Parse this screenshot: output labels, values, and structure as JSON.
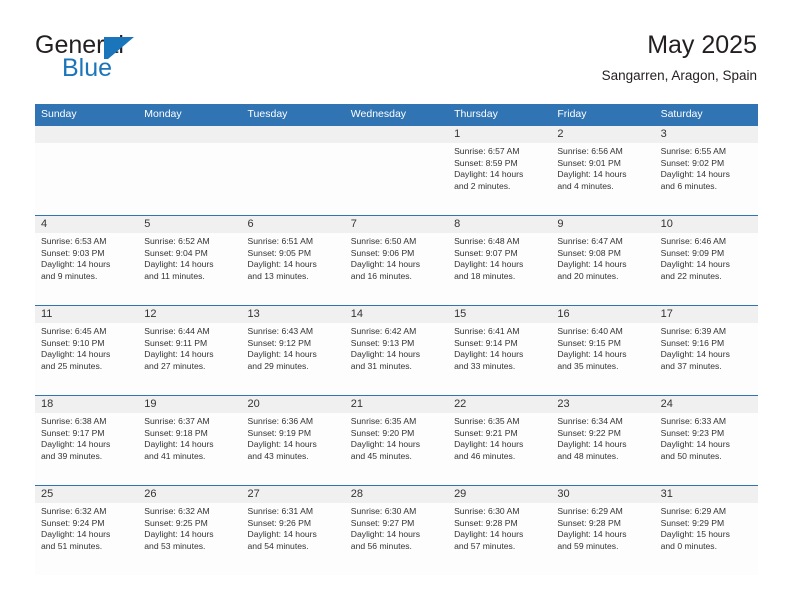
{
  "brand": {
    "name_part1": "General",
    "name_part2": "Blue",
    "accent_color": "#1b75bb"
  },
  "header": {
    "title": "May 2025",
    "location": "Sangarren, Aragon, Spain"
  },
  "calendar": {
    "header_color": "#3174b4",
    "weekdays": [
      "Sunday",
      "Monday",
      "Tuesday",
      "Wednesday",
      "Thursday",
      "Friday",
      "Saturday"
    ],
    "weeks": [
      [
        {
          "day": "",
          "lines": []
        },
        {
          "day": "",
          "lines": []
        },
        {
          "day": "",
          "lines": []
        },
        {
          "day": "",
          "lines": []
        },
        {
          "day": "1",
          "lines": [
            "Sunrise: 6:57 AM",
            "Sunset: 8:59 PM",
            "Daylight: 14 hours",
            "and 2 minutes."
          ]
        },
        {
          "day": "2",
          "lines": [
            "Sunrise: 6:56 AM",
            "Sunset: 9:01 PM",
            "Daylight: 14 hours",
            "and 4 minutes."
          ]
        },
        {
          "day": "3",
          "lines": [
            "Sunrise: 6:55 AM",
            "Sunset: 9:02 PM",
            "Daylight: 14 hours",
            "and 6 minutes."
          ]
        }
      ],
      [
        {
          "day": "4",
          "lines": [
            "Sunrise: 6:53 AM",
            "Sunset: 9:03 PM",
            "Daylight: 14 hours",
            "and 9 minutes."
          ]
        },
        {
          "day": "5",
          "lines": [
            "Sunrise: 6:52 AM",
            "Sunset: 9:04 PM",
            "Daylight: 14 hours",
            "and 11 minutes."
          ]
        },
        {
          "day": "6",
          "lines": [
            "Sunrise: 6:51 AM",
            "Sunset: 9:05 PM",
            "Daylight: 14 hours",
            "and 13 minutes."
          ]
        },
        {
          "day": "7",
          "lines": [
            "Sunrise: 6:50 AM",
            "Sunset: 9:06 PM",
            "Daylight: 14 hours",
            "and 16 minutes."
          ]
        },
        {
          "day": "8",
          "lines": [
            "Sunrise: 6:48 AM",
            "Sunset: 9:07 PM",
            "Daylight: 14 hours",
            "and 18 minutes."
          ]
        },
        {
          "day": "9",
          "lines": [
            "Sunrise: 6:47 AM",
            "Sunset: 9:08 PM",
            "Daylight: 14 hours",
            "and 20 minutes."
          ]
        },
        {
          "day": "10",
          "lines": [
            "Sunrise: 6:46 AM",
            "Sunset: 9:09 PM",
            "Daylight: 14 hours",
            "and 22 minutes."
          ]
        }
      ],
      [
        {
          "day": "11",
          "lines": [
            "Sunrise: 6:45 AM",
            "Sunset: 9:10 PM",
            "Daylight: 14 hours",
            "and 25 minutes."
          ]
        },
        {
          "day": "12",
          "lines": [
            "Sunrise: 6:44 AM",
            "Sunset: 9:11 PM",
            "Daylight: 14 hours",
            "and 27 minutes."
          ]
        },
        {
          "day": "13",
          "lines": [
            "Sunrise: 6:43 AM",
            "Sunset: 9:12 PM",
            "Daylight: 14 hours",
            "and 29 minutes."
          ]
        },
        {
          "day": "14",
          "lines": [
            "Sunrise: 6:42 AM",
            "Sunset: 9:13 PM",
            "Daylight: 14 hours",
            "and 31 minutes."
          ]
        },
        {
          "day": "15",
          "lines": [
            "Sunrise: 6:41 AM",
            "Sunset: 9:14 PM",
            "Daylight: 14 hours",
            "and 33 minutes."
          ]
        },
        {
          "day": "16",
          "lines": [
            "Sunrise: 6:40 AM",
            "Sunset: 9:15 PM",
            "Daylight: 14 hours",
            "and 35 minutes."
          ]
        },
        {
          "day": "17",
          "lines": [
            "Sunrise: 6:39 AM",
            "Sunset: 9:16 PM",
            "Daylight: 14 hours",
            "and 37 minutes."
          ]
        }
      ],
      [
        {
          "day": "18",
          "lines": [
            "Sunrise: 6:38 AM",
            "Sunset: 9:17 PM",
            "Daylight: 14 hours",
            "and 39 minutes."
          ]
        },
        {
          "day": "19",
          "lines": [
            "Sunrise: 6:37 AM",
            "Sunset: 9:18 PM",
            "Daylight: 14 hours",
            "and 41 minutes."
          ]
        },
        {
          "day": "20",
          "lines": [
            "Sunrise: 6:36 AM",
            "Sunset: 9:19 PM",
            "Daylight: 14 hours",
            "and 43 minutes."
          ]
        },
        {
          "day": "21",
          "lines": [
            "Sunrise: 6:35 AM",
            "Sunset: 9:20 PM",
            "Daylight: 14 hours",
            "and 45 minutes."
          ]
        },
        {
          "day": "22",
          "lines": [
            "Sunrise: 6:35 AM",
            "Sunset: 9:21 PM",
            "Daylight: 14 hours",
            "and 46 minutes."
          ]
        },
        {
          "day": "23",
          "lines": [
            "Sunrise: 6:34 AM",
            "Sunset: 9:22 PM",
            "Daylight: 14 hours",
            "and 48 minutes."
          ]
        },
        {
          "day": "24",
          "lines": [
            "Sunrise: 6:33 AM",
            "Sunset: 9:23 PM",
            "Daylight: 14 hours",
            "and 50 minutes."
          ]
        }
      ],
      [
        {
          "day": "25",
          "lines": [
            "Sunrise: 6:32 AM",
            "Sunset: 9:24 PM",
            "Daylight: 14 hours",
            "and 51 minutes."
          ]
        },
        {
          "day": "26",
          "lines": [
            "Sunrise: 6:32 AM",
            "Sunset: 9:25 PM",
            "Daylight: 14 hours",
            "and 53 minutes."
          ]
        },
        {
          "day": "27",
          "lines": [
            "Sunrise: 6:31 AM",
            "Sunset: 9:26 PM",
            "Daylight: 14 hours",
            "and 54 minutes."
          ]
        },
        {
          "day": "28",
          "lines": [
            "Sunrise: 6:30 AM",
            "Sunset: 9:27 PM",
            "Daylight: 14 hours",
            "and 56 minutes."
          ]
        },
        {
          "day": "29",
          "lines": [
            "Sunrise: 6:30 AM",
            "Sunset: 9:28 PM",
            "Daylight: 14 hours",
            "and 57 minutes."
          ]
        },
        {
          "day": "30",
          "lines": [
            "Sunrise: 6:29 AM",
            "Sunset: 9:28 PM",
            "Daylight: 14 hours",
            "and 59 minutes."
          ]
        },
        {
          "day": "31",
          "lines": [
            "Sunrise: 6:29 AM",
            "Sunset: 9:29 PM",
            "Daylight: 15 hours",
            "and 0 minutes."
          ]
        }
      ]
    ]
  }
}
